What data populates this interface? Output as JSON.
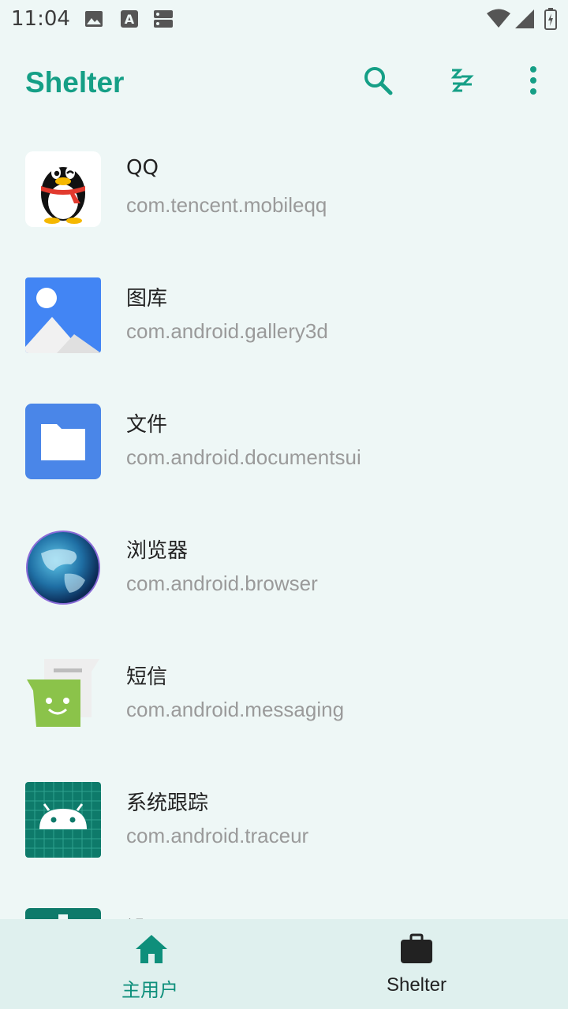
{
  "status_bar": {
    "time": "11:04",
    "icons": [
      "image-icon",
      "a-icon",
      "storage-icon",
      "wifi-icon",
      "signal-icon",
      "battery-icon"
    ]
  },
  "app_bar": {
    "title": "Shelter",
    "actions": [
      "search-icon",
      "sleep-zzz-icon",
      "more-vert-icon"
    ],
    "accent_color": "#159f86"
  },
  "apps": [
    {
      "name": "QQ",
      "package": "com.tencent.mobileqq",
      "icon": "qq-penguin-icon"
    },
    {
      "name": "图库",
      "package": "com.android.gallery3d",
      "icon": "gallery-icon"
    },
    {
      "name": "文件",
      "package": "com.android.documentsui",
      "icon": "files-folder-icon"
    },
    {
      "name": "浏览器",
      "package": "com.android.browser",
      "icon": "browser-globe-icon"
    },
    {
      "name": "短信",
      "package": "com.android.messaging",
      "icon": "messaging-icon"
    },
    {
      "name": "系统跟踪",
      "package": "com.android.traceur",
      "icon": "traceur-android-icon"
    },
    {
      "name": "设置",
      "package": "",
      "icon": "settings-icon"
    }
  ],
  "bottom_nav": {
    "items": [
      {
        "label": "主用户",
        "icon": "home-icon",
        "selected": true
      },
      {
        "label": "Shelter",
        "icon": "briefcase-icon",
        "selected": false
      }
    ],
    "selected_color": "#0e8f7b",
    "unselected_color": "#222222"
  }
}
